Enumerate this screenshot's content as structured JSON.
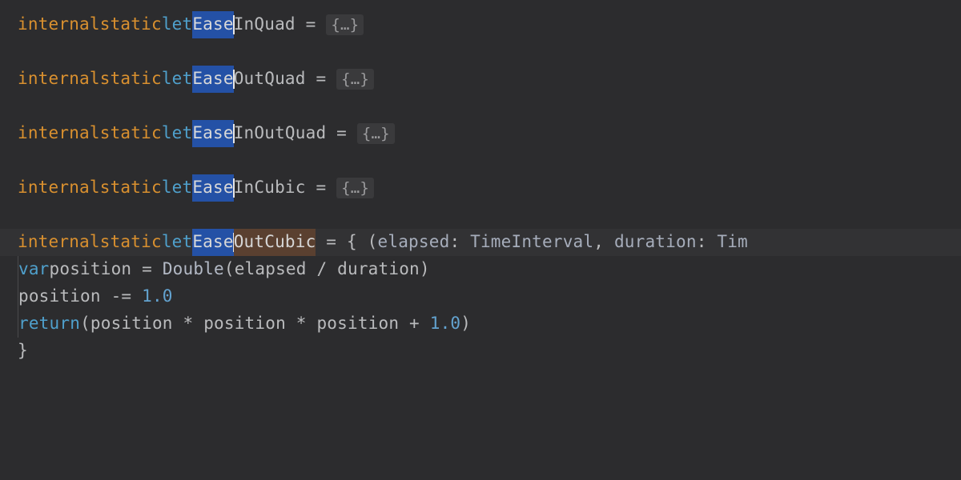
{
  "tokens": {
    "internal": "internal",
    "static": "static",
    "let": "let",
    "var": "var",
    "return": "return",
    "ease": "Ease",
    "inQuad": "InQuad",
    "outQuad": "OutQuad",
    "inOutQuad": "InOutQuad",
    "inCubic": "InCubic",
    "outCubic": "OutCubic",
    "eq": " = ",
    "fold": "{…}",
    "closureOpen": "{ (",
    "elapsed": "elapsed",
    "colon": ": ",
    "timeInterval": "TimeInterval",
    "comma": ", ",
    "duration": "duration",
    "timTrunc": "Tim",
    "position": "position",
    "double": "Double",
    "slash": " / ",
    "minusEq": " -= ",
    "one": "1.0",
    "star": " * ",
    "plus": " + ",
    "openParen": "(",
    "closeParen": ")",
    "closeBrace": "}"
  }
}
